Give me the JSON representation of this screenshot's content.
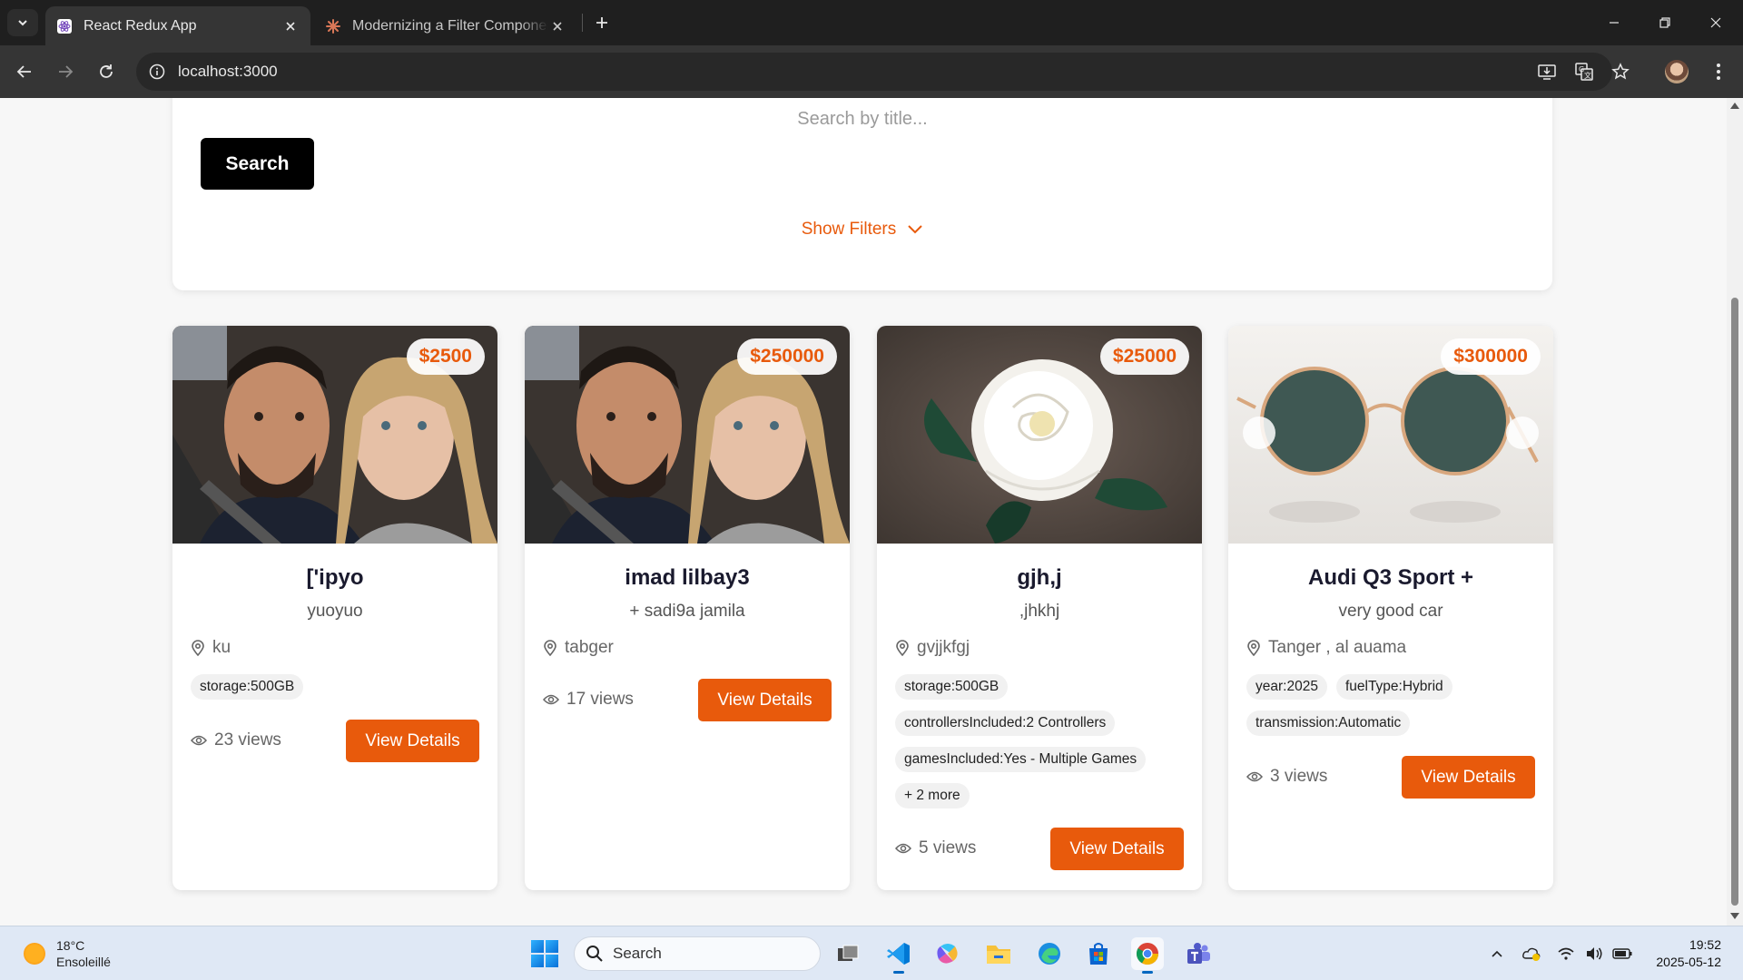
{
  "browser": {
    "tabs": [
      {
        "title": "React Redux App",
        "active": true
      },
      {
        "title": "Modernizing a Filter Component",
        "active": false
      }
    ],
    "url": "localhost:3000"
  },
  "search": {
    "placeholder": "Search by title...",
    "button_label": "Search",
    "filters_label": "Show Filters"
  },
  "cards": [
    {
      "price": "$2500",
      "title": "['ipyo",
      "subtitle": "yuoyuo",
      "location": "ku",
      "tags": [
        "storage:500GB"
      ],
      "views": "23 views",
      "button_label": "View Details",
      "image": "couple-selfie-photo"
    },
    {
      "price": "$250000",
      "title": "imad lilbay3",
      "subtitle": "+ sadi9a jamila",
      "location": "tabger",
      "tags": [],
      "views": "17 views",
      "button_label": "View Details",
      "image": "couple-selfie-photo"
    },
    {
      "price": "$25000",
      "title": "gjh,j",
      "subtitle": ",jhkhj",
      "location": "gvjjkfgj",
      "tags": [
        "storage:500GB",
        "controllersIncluded:2 Controllers",
        "gamesIncluded:Yes - Multiple Games",
        "+ 2 more"
      ],
      "views": "5 views",
      "button_label": "View Details",
      "image": "white-rose-photo"
    },
    {
      "price": "$300000",
      "title": "Audi Q3 Sport +",
      "subtitle": "very good car",
      "location": "Tanger , al auama",
      "tags": [
        "year:2025",
        "fuelType:Hybrid",
        "transmission:Automatic"
      ],
      "views": "3 views",
      "button_label": "View Details",
      "image": "sunglasses-photo"
    }
  ],
  "taskbar": {
    "weather": {
      "temp": "18°C",
      "condition": "Ensoleillé"
    },
    "search_placeholder": "Search",
    "clock": {
      "time": "19:52",
      "date": "2025-05-12"
    }
  },
  "colors": {
    "accent": "#e85a0c",
    "search_button": "#000000",
    "title_text": "#1a1a2e"
  }
}
